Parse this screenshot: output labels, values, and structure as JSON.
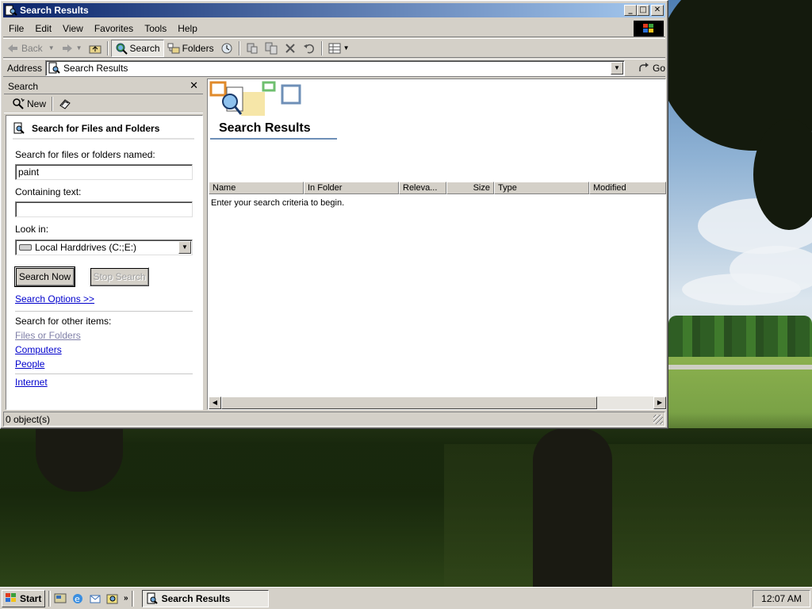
{
  "window": {
    "title": "Search Results",
    "menu": [
      "File",
      "Edit",
      "View",
      "Favorites",
      "Tools",
      "Help"
    ],
    "toolbar": {
      "back": "Back",
      "search": "Search",
      "folders": "Folders"
    },
    "address": {
      "label": "Address",
      "value": "Search Results",
      "go": "Go"
    },
    "status": "0 object(s)"
  },
  "search_pane": {
    "header": "Search",
    "new_label": "New",
    "section_title": "Search for Files and Folders",
    "named_label": "Search for files or folders named:",
    "named_value": "paint",
    "containing_label": "Containing text:",
    "containing_value": "",
    "look_in_label": "Look in:",
    "look_in_value": "Local Harddrives (C:;E:)",
    "search_now": "Search Now",
    "stop_search": "Stop Search",
    "search_options": "Search Options >>",
    "other_items_label": "Search for other items:",
    "other_items": [
      "Files or Folders",
      "Computers",
      "People"
    ],
    "internet": "Internet"
  },
  "results": {
    "title": "Search Results",
    "columns": [
      "Name",
      "In Folder",
      "Releva...",
      "Size",
      "Type",
      "Modified"
    ],
    "empty_message": "Enter your search criteria to begin."
  },
  "taskbar": {
    "start": "Start",
    "task": "Search Results",
    "clock": "12:07 AM"
  },
  "colors": {
    "title_gradient_start": "#0a246a",
    "title_gradient_end": "#a6caf0",
    "link": "#0000cc",
    "face": "#d4d0c8"
  }
}
